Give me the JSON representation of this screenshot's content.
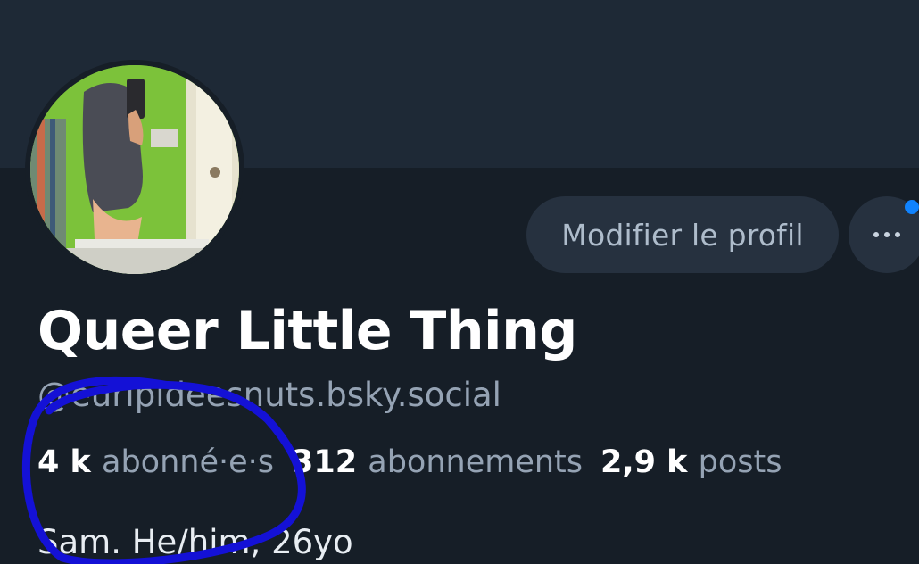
{
  "profile": {
    "display_name": "Queer Little Thing",
    "handle": "@euripideesnuts.bsky.social",
    "edit_button_label": "Modifier le profil",
    "more_button_label": "•••",
    "bio": "Sam. He/him, 26yo"
  },
  "stats": {
    "followers_count": "4 k",
    "followers_label": "abonné·e·s",
    "following_count": "312",
    "following_label": "abonnements",
    "posts_count": "2,9 k",
    "posts_label": "posts"
  },
  "colors": {
    "background": "#161e27",
    "banner": "#1e2936",
    "button_bg": "#26313f",
    "muted_text": "#95a3b4",
    "notification_dot": "#1083fe",
    "annotation_stroke": "#1411d6"
  },
  "icons": {
    "more": "ellipsis-icon",
    "notification": "notification-dot"
  }
}
